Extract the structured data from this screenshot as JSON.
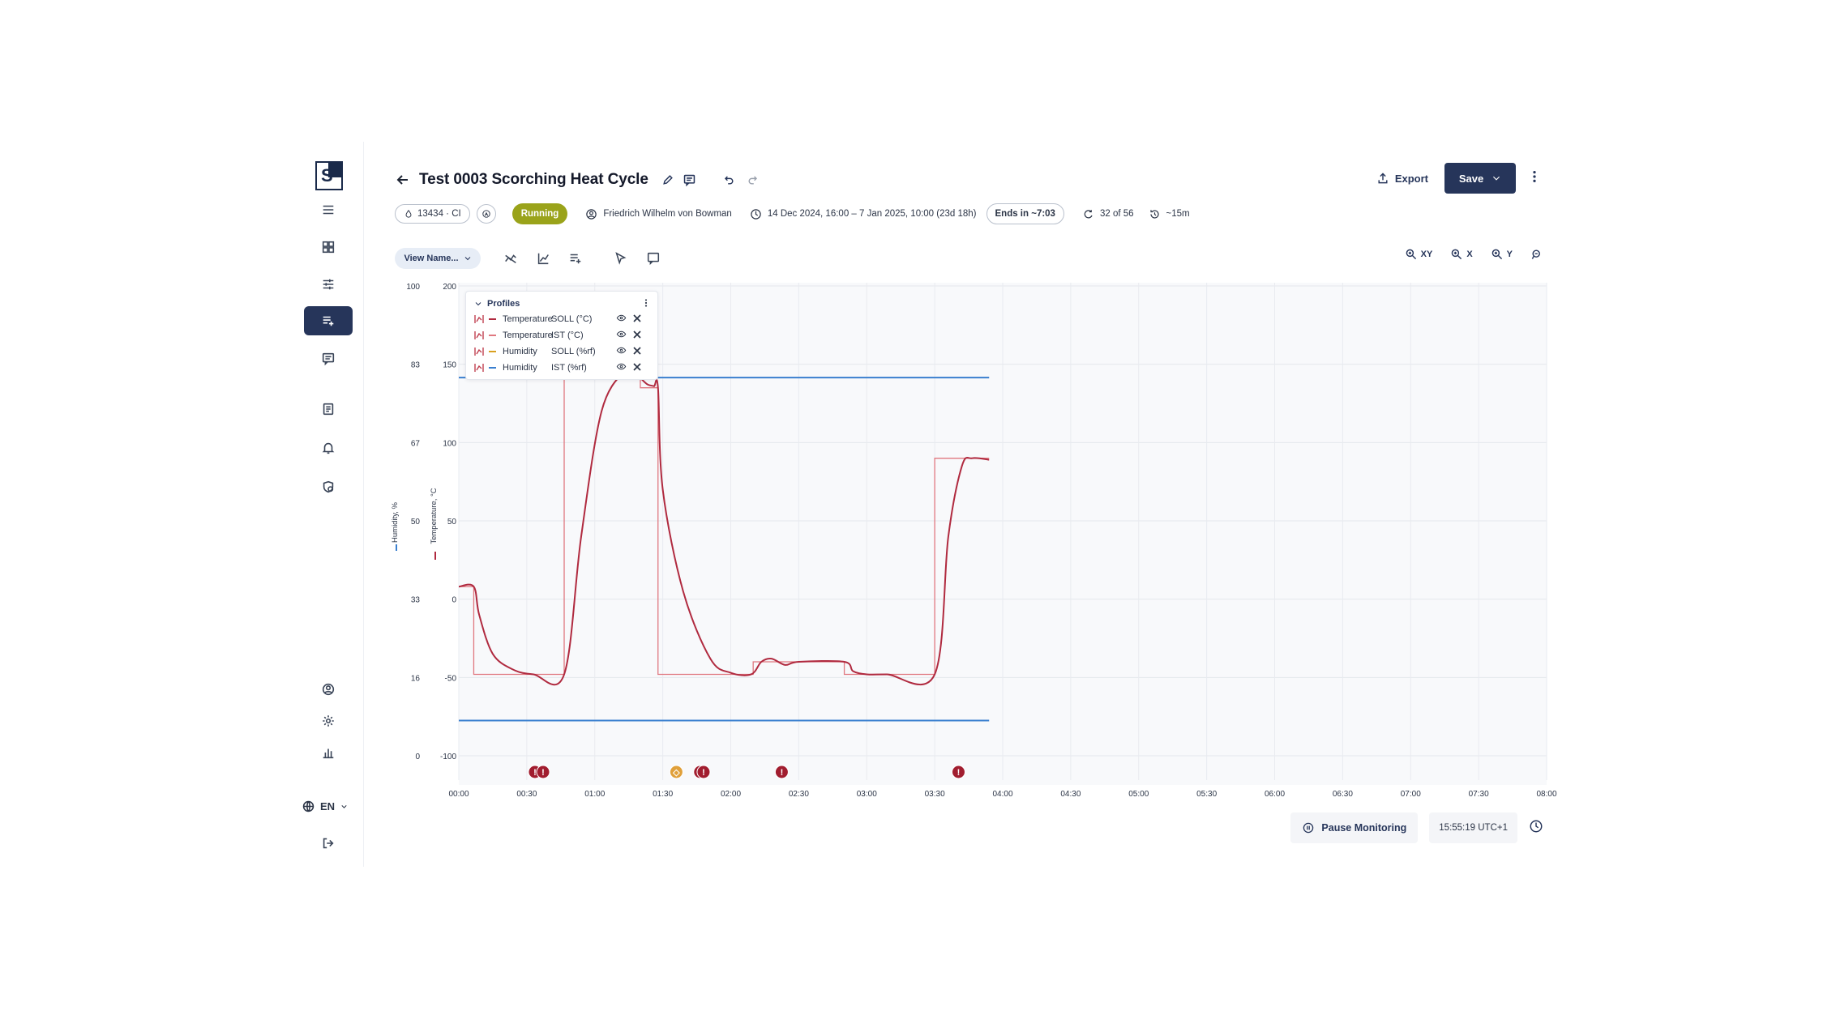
{
  "sidebar": {
    "logo_letter": "S",
    "items": [
      {
        "name": "menu-icon",
        "active": false
      },
      {
        "name": "dashboard-icon",
        "active": false
      },
      {
        "name": "sliders-icon",
        "active": false
      },
      {
        "name": "test-list-icon",
        "active": true
      },
      {
        "name": "chat-icon",
        "active": false
      },
      {
        "name": "document-icon",
        "active": false
      },
      {
        "name": "bell-icon",
        "active": false
      },
      {
        "name": "shield-clock-icon",
        "active": false
      },
      {
        "name": "user-icon",
        "active": false
      },
      {
        "name": "gear-icon",
        "active": false
      },
      {
        "name": "bar-chart-icon",
        "active": false
      }
    ],
    "language": "EN",
    "logout_icon": "logout-icon"
  },
  "header": {
    "title": "Test 0003 Scorching Heat Cycle",
    "export_label": "Export",
    "save_label": "Save",
    "chamber_chip": "13434 · CI",
    "status": "Running",
    "status_color": "#9aa31a",
    "operator": "Friedrich Wilhelm von Bowman",
    "date_range": "14 Dec 2024, 16:00 – 7 Jan 2025, 10:00 (23d 18h)",
    "ends_in": "Ends in ~7:03",
    "cycle": "32 of 56",
    "interval": "~15m"
  },
  "toolbar": {
    "view_name": "View Name...",
    "zoom_xy": "XY",
    "zoom_x": "X",
    "zoom_y": "Y"
  },
  "legend": {
    "title": "Profiles",
    "rows": [
      {
        "name": "Temperature",
        "variable": "SOLL (°C)",
        "color": "#b02a3f"
      },
      {
        "name": "Temperature",
        "variable": "IST (°C)",
        "color": "#e07880"
      },
      {
        "name": "Humidity",
        "variable": "SOLL (%rf)",
        "color": "#d9a020"
      },
      {
        "name": "Humidity",
        "variable": "IST (%rf)",
        "color": "#3a7fcf"
      }
    ]
  },
  "chart_data": {
    "type": "line",
    "x_ticks": [
      "00:00",
      "00:30",
      "01:00",
      "01:30",
      "02:00",
      "02:30",
      "03:00",
      "03:30",
      "04:00",
      "04:30",
      "05:00",
      "05:30",
      "06:00",
      "06:30",
      "07:00",
      "07:30",
      "08:00"
    ],
    "y_left_humidity_ticks": [
      "100",
      "83",
      "67",
      "50",
      "33",
      "16",
      "0"
    ],
    "y_left_temperature_ticks": [
      "200",
      "150",
      "100",
      "50",
      "0",
      "-50",
      "-100"
    ],
    "ylabel_humidity": "Humidity, %",
    "ylabel_temperature": "Temperature, °C",
    "ylim_temperature": [
      -100,
      200
    ],
    "grid": true,
    "legend_placement": "top-left",
    "series": [
      {
        "name": "Temperature SOLL (°C)",
        "color": "#e07880",
        "shape": "step",
        "x_hours": [
          0.0,
          0.22,
          0.22,
          1.55,
          1.55,
          2.67,
          2.67,
          2.93,
          2.93,
          4.33,
          4.33,
          5.67,
          5.67,
          7.0,
          7.0,
          7.8
        ],
        "values": [
          8,
          8,
          -48,
          -48,
          142,
          142,
          135,
          135,
          -48,
          -48,
          -40,
          -40,
          -48,
          -48,
          90,
          90
        ]
      },
      {
        "name": "Temperature IST (°C)",
        "color": "#b02a3f",
        "shape": "line",
        "x_hours": [
          0.0,
          0.22,
          0.3,
          0.5,
          0.8,
          1.1,
          1.55,
          1.8,
          2.1,
          2.45,
          2.6,
          2.7,
          2.78,
          2.87,
          2.93,
          3.0,
          3.3,
          3.7,
          4.0,
          4.3,
          4.45,
          4.6,
          4.8,
          5.0,
          5.67,
          5.8,
          6.0,
          6.3,
          7.0,
          7.2,
          7.4,
          7.55,
          7.8
        ],
        "values": [
          8,
          8,
          -10,
          -35,
          -45,
          -48,
          -48,
          40,
          120,
          146,
          145,
          140,
          137,
          136,
          135,
          70,
          5,
          -38,
          -47,
          -48,
          -40,
          -38,
          -42,
          -40,
          -40,
          -46,
          -48,
          -48,
          -48,
          40,
          85,
          90,
          89
        ]
      },
      {
        "name": "Humidity IST (%rf) upper",
        "color": "#3a7fcf",
        "shape": "line",
        "x_hours": [
          0.0,
          7.8
        ],
        "values_humidity": [
          80.5,
          80.5
        ]
      },
      {
        "name": "Humidity IST (%rf) lower",
        "color": "#3a7fcf",
        "shape": "line",
        "x_hours": [
          0.0,
          7.8
        ],
        "values_humidity": [
          7.5,
          7.5
        ]
      }
    ],
    "alarms": [
      {
        "x_hours": 1.12,
        "type": "error"
      },
      {
        "x_hours": 1.24,
        "type": "error"
      },
      {
        "x_hours": 3.2,
        "type": "warning"
      },
      {
        "x_hours": 3.55,
        "type": "error"
      },
      {
        "x_hours": 3.6,
        "type": "error"
      },
      {
        "x_hours": 4.75,
        "type": "error"
      },
      {
        "x_hours": 7.35,
        "type": "error"
      }
    ],
    "alarm_colors": {
      "error": "#a11d2f",
      "warning": "#e0a03a"
    }
  },
  "footer": {
    "pause_label": "Pause Monitoring",
    "time": "15:55:19 UTC+1"
  }
}
